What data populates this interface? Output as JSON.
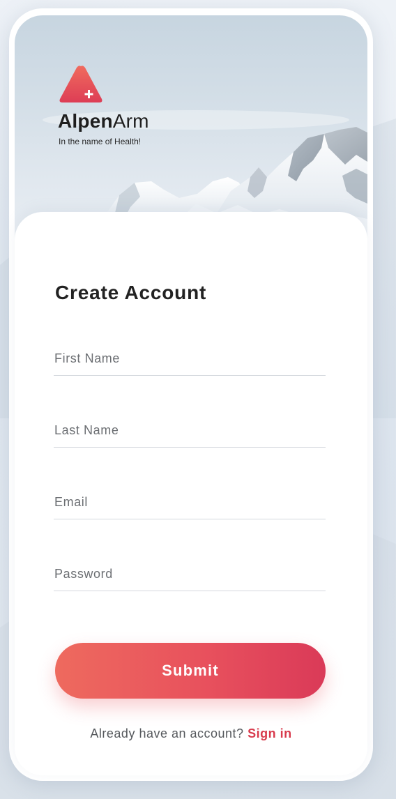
{
  "brand": {
    "name_bold": "Alpen",
    "name_light": "Arm",
    "tagline": "In the name of Health!",
    "logo_icon": "red-triangle-plus-icon",
    "accent_color": "#e8515d"
  },
  "form": {
    "title": "Create Account",
    "fields": {
      "first_name": {
        "placeholder": "First Name",
        "value": ""
      },
      "last_name": {
        "placeholder": "Last Name",
        "value": ""
      },
      "email": {
        "placeholder": "Email",
        "value": ""
      },
      "password": {
        "placeholder": "Password",
        "value": ""
      }
    },
    "submit_label": "Submit"
  },
  "footer": {
    "prompt": "Already have an account?",
    "signin_label": "Sign in",
    "link_color": "#d83a4c"
  }
}
